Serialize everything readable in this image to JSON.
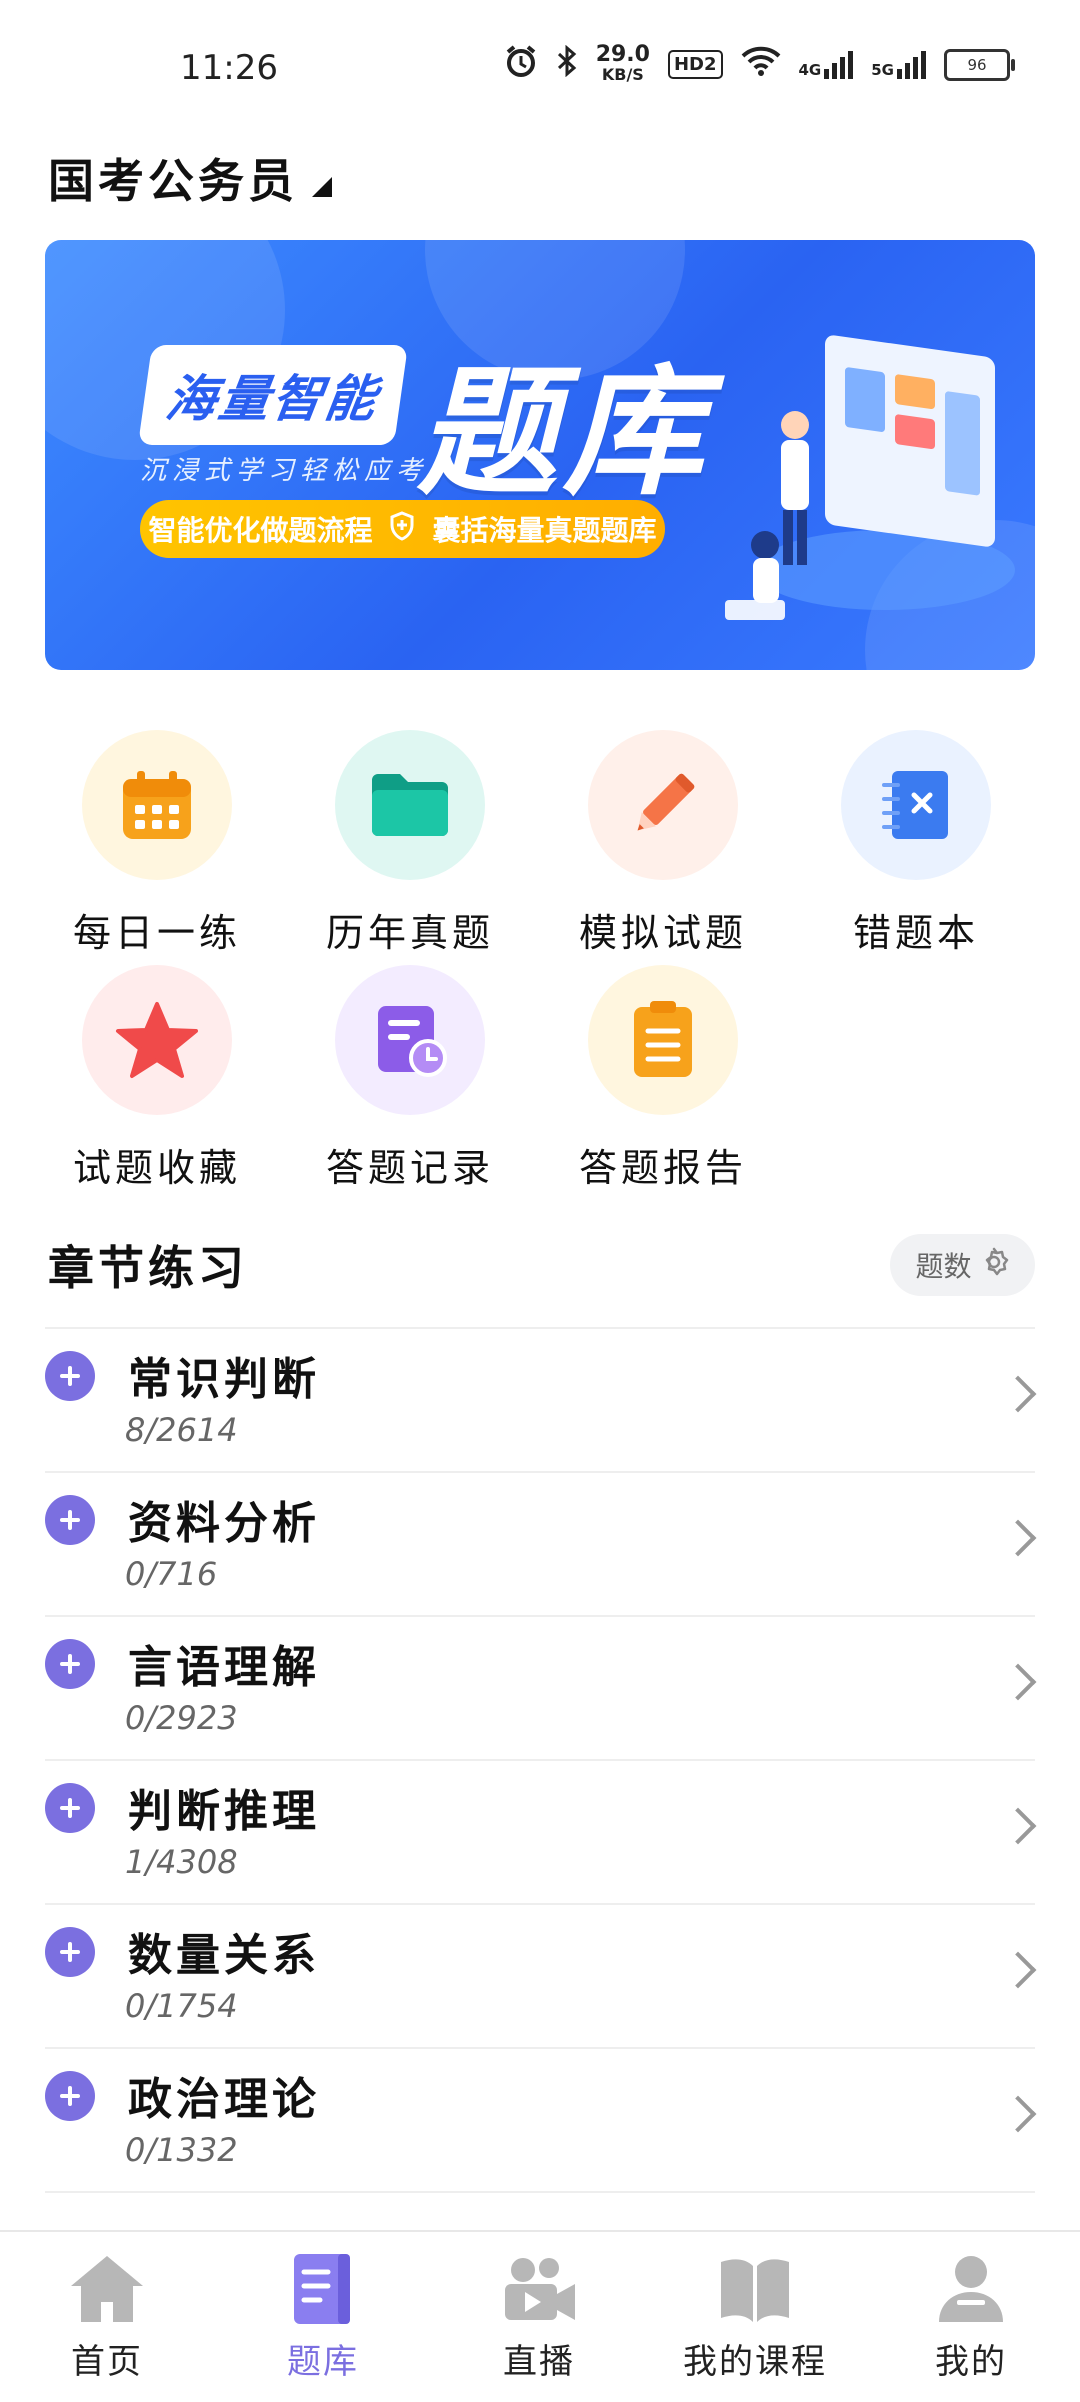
{
  "status_bar": {
    "time": "11:26",
    "speed_value": "29.0",
    "speed_unit": "KB/S",
    "hd_label": "HD2",
    "net1": "4G",
    "net2": "5G",
    "battery": "96",
    "icons": [
      "alarm-icon",
      "bluetooth-icon",
      "wifi-icon",
      "signal-icon",
      "battery-icon"
    ]
  },
  "header": {
    "title": "国考公务员"
  },
  "banner": {
    "tag": "海量智能",
    "big_text": "题库",
    "slogan": "沉浸式学习轻松应考",
    "pill_left": "智能优化做题流程",
    "pill_right": "囊括海量真题题库"
  },
  "features": [
    {
      "label": "每日一练",
      "icon": "calendar-icon",
      "bg": "#fff6df",
      "color": "#f7a21b"
    },
    {
      "label": "历年真题",
      "icon": "folder-icon",
      "bg": "#dff7f2",
      "color": "#17b89b"
    },
    {
      "label": "模拟试题",
      "icon": "pencil-icon",
      "bg": "#fff0ea",
      "color": "#f57447"
    },
    {
      "label": "错题本",
      "icon": "notebook-icon",
      "bg": "#eaf2ff",
      "color": "#3b7bf0"
    },
    {
      "label": "试题收藏",
      "icon": "star-icon",
      "bg": "#ffecec",
      "color": "#f04a4a"
    },
    {
      "label": "答题记录",
      "icon": "record-icon",
      "bg": "#f3ecff",
      "color": "#8c5ce8"
    },
    {
      "label": "答题报告",
      "icon": "clipboard-icon",
      "bg": "#fff6df",
      "color": "#f7a21b"
    }
  ],
  "chapter_section": {
    "title": "章节练习",
    "setting_label": "题数"
  },
  "chapters": [
    {
      "name": "常识判断",
      "count": "8/2614"
    },
    {
      "name": "资料分析",
      "count": "0/716"
    },
    {
      "name": "言语理解",
      "count": "0/2923"
    },
    {
      "name": "判断推理",
      "count": "1/4308"
    },
    {
      "name": "数量关系",
      "count": "0/1754"
    },
    {
      "name": "政治理论",
      "count": "0/1332"
    }
  ],
  "bottom_nav": [
    {
      "label": "首页",
      "icon": "home-icon",
      "active": false
    },
    {
      "label": "题库",
      "icon": "question-bank-icon",
      "active": true
    },
    {
      "label": "直播",
      "icon": "live-camera-icon",
      "active": false
    },
    {
      "label": "我的课程",
      "icon": "book-icon",
      "active": false
    },
    {
      "label": "我的",
      "icon": "user-icon",
      "active": false
    }
  ],
  "colors": {
    "accent": "#7b6fe0",
    "banner_blue": "#2a63f2",
    "inactive_icon": "#b7b7b7"
  }
}
